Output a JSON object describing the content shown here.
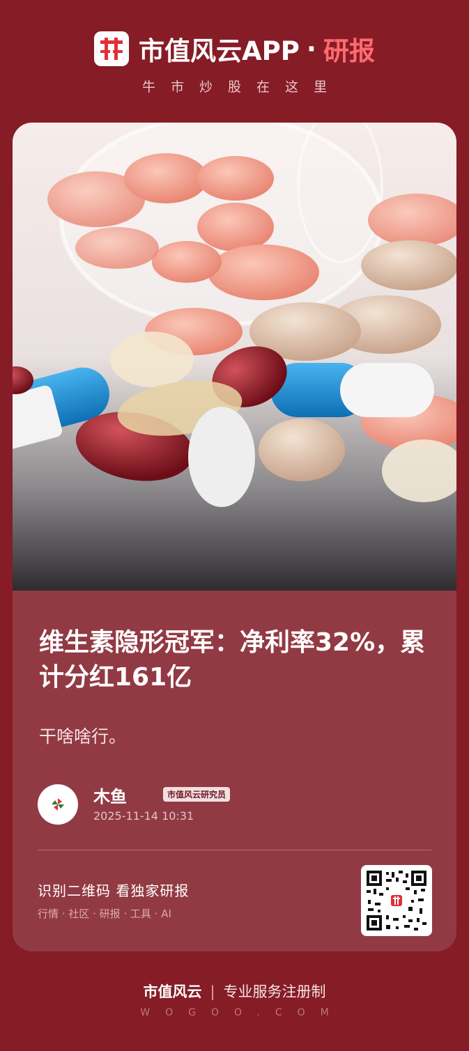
{
  "header": {
    "app_name": "市值风云APP",
    "dot": "·",
    "section": "研报",
    "slogan": "牛市炒股在这里",
    "logo_icon": "shi-logo-icon",
    "accent_color": "#ff6b70"
  },
  "article": {
    "title": "维生素隐形冠军：净利率32%，累计分红161亿",
    "subtitle": "干啥啥行。",
    "author": {
      "name": "木鱼",
      "badge": "市值风云研究员",
      "time": "2025-11-14 10:31"
    }
  },
  "qr": {
    "title": "识别二维码 看独家研报",
    "subtitle": "行情 · 社区 · 研报 · 工具 · AI"
  },
  "footer": {
    "brand": "市值风云",
    "separator": "|",
    "tagline": "专业服务注册制",
    "url": "WOGOO.COM"
  },
  "colors": {
    "background": "#861c26",
    "card": "#923a44"
  }
}
